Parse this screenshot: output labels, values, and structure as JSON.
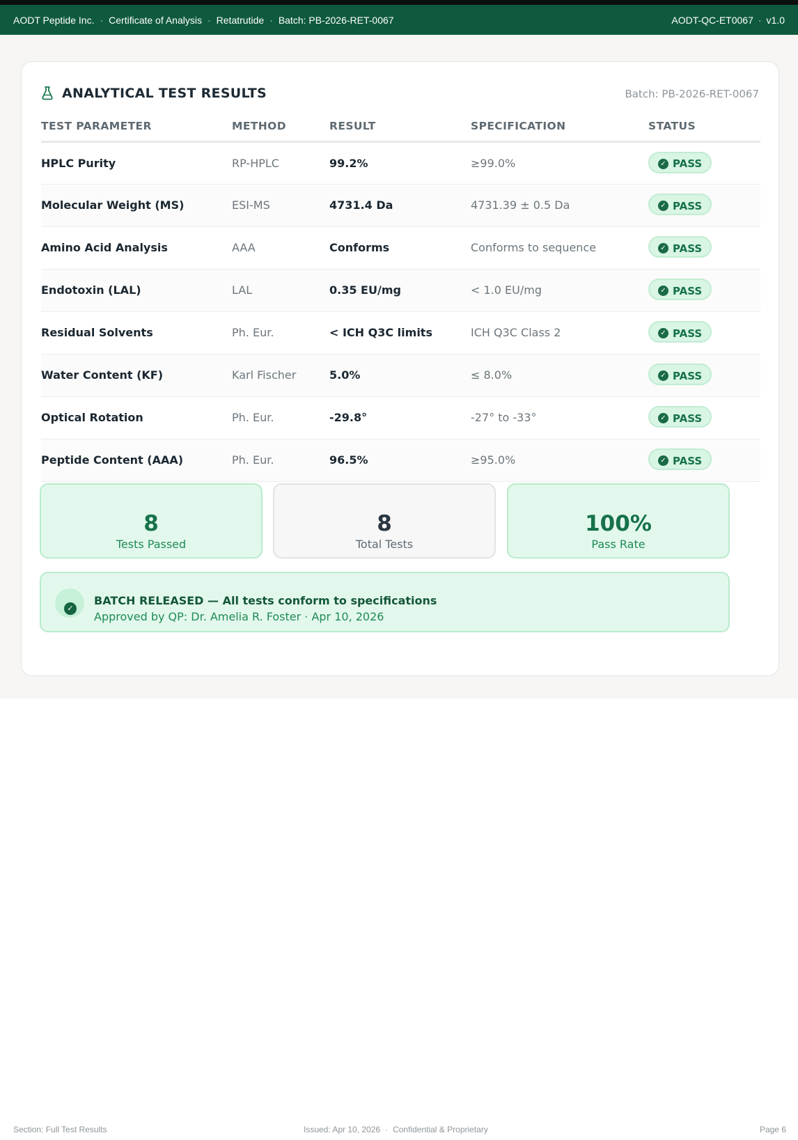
{
  "header": {
    "company": "AODT Peptide Inc.",
    "document": "Certificate of Analysis",
    "product": "Retatrutide",
    "batch": "Batch: PB-2026-RET-0067",
    "doc_code": "AODT-QC-ET0067",
    "version": "v1.0",
    "separator": "·"
  },
  "section": {
    "title": "ANALYTICAL TEST RESULTS",
    "title_icon": "flask-icon",
    "batch_ref": "Batch: PB-2026-RET-0067"
  },
  "table": {
    "columns": [
      "TEST PARAMETER",
      "METHOD",
      "RESULT",
      "SPECIFICATION",
      "STATUS"
    ],
    "rows": [
      {
        "parameter": "HPLC Purity",
        "method": "RP-HPLC",
        "result": "99.2%",
        "specification": "≥99.0%",
        "status": "PASS"
      },
      {
        "parameter": "Molecular Weight (MS)",
        "method": "ESI-MS",
        "result": "4731.4 Da",
        "specification": "4731.39 ± 0.5 Da",
        "status": "PASS"
      },
      {
        "parameter": "Amino Acid Analysis",
        "method": "AAA",
        "result": "Conforms",
        "specification": "Conforms to sequence",
        "status": "PASS"
      },
      {
        "parameter": "Endotoxin (LAL)",
        "method": "LAL",
        "result": "0.35 EU/mg",
        "specification": "< 1.0 EU/mg",
        "status": "PASS"
      },
      {
        "parameter": "Residual Solvents",
        "method": "Ph. Eur.",
        "result": "< ICH Q3C limits",
        "specification": "ICH Q3C Class 2",
        "status": "PASS"
      },
      {
        "parameter": "Water Content (KF)",
        "method": "Karl Fischer",
        "result": "5.0%",
        "specification": "≤ 8.0%",
        "status": "PASS"
      },
      {
        "parameter": "Optical Rotation",
        "method": "Ph. Eur.",
        "result": "-29.8°",
        "specification": "-27° to -33°",
        "status": "PASS"
      },
      {
        "parameter": "Peptide Content (AAA)",
        "method": "Ph. Eur.",
        "result": "96.5%",
        "specification": "≥95.0%",
        "status": "PASS"
      }
    ],
    "status_icon": "check-circle-icon"
  },
  "summary": {
    "passed": {
      "value": "8",
      "label": "Tests Passed"
    },
    "total": {
      "value": "8",
      "label": "Total Tests"
    },
    "rate": {
      "value": "100%",
      "label": "Pass Rate"
    }
  },
  "release": {
    "headline": "BATCH RELEASED — All tests conform to specifications",
    "approval": "Approved by QP: Dr. Amelia R. Foster · Apr 10, 2026",
    "icon": "check-circle-icon"
  },
  "footer": {
    "section": "Section: Full Test Results",
    "issued": "Issued: Apr 10, 2026",
    "confidentiality": "Confidential & Proprietary",
    "page": "Page 6",
    "separator": "·"
  },
  "colors": {
    "brand": "#0f5a3e",
    "pass_bg": "#d9f5e4",
    "pass_text": "#16724a"
  }
}
